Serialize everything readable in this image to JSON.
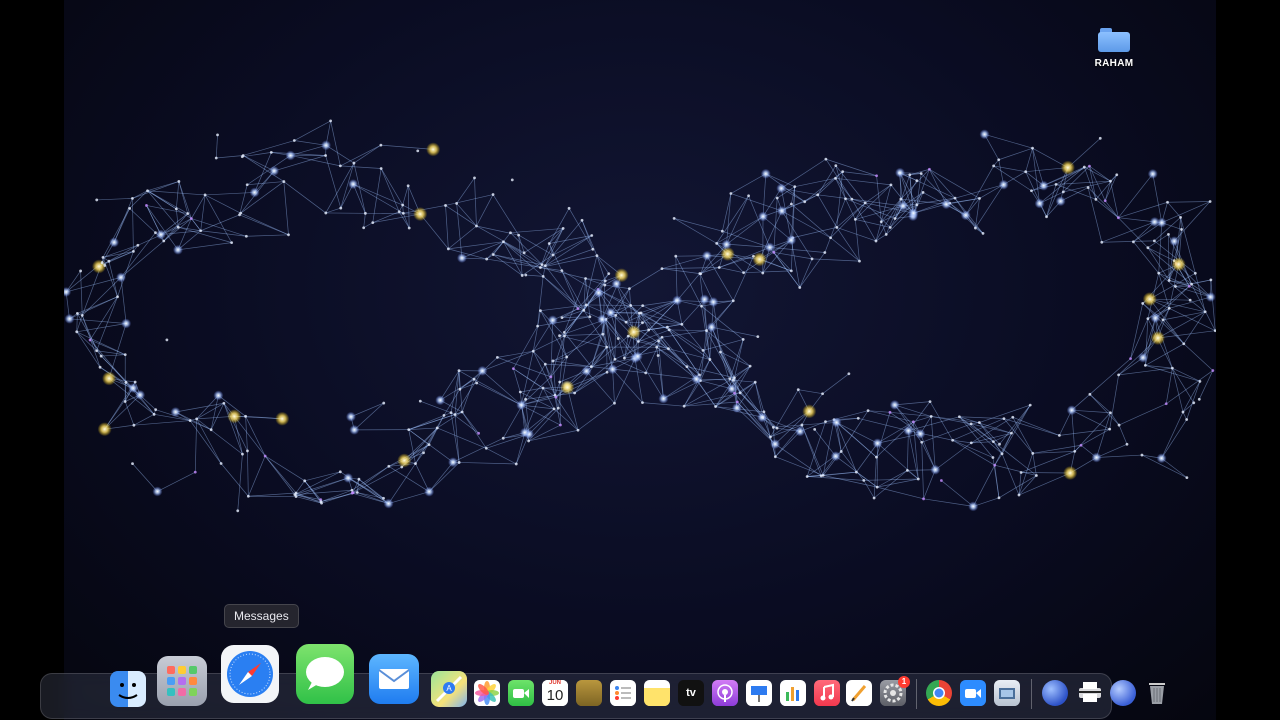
{
  "desktop": {
    "folder": {
      "label": "RAHAM",
      "icon": "folder-icon"
    }
  },
  "tooltip": {
    "text": "Messages"
  },
  "dock": {
    "apps": [
      {
        "id": "finder",
        "icon": "finder-icon"
      },
      {
        "id": "launchpad",
        "icon": "launchpad-icon"
      },
      {
        "id": "safari",
        "icon": "safari-icon"
      },
      {
        "id": "messages",
        "icon": "messages-icon"
      },
      {
        "id": "mail",
        "icon": "mail-icon"
      },
      {
        "id": "maps",
        "icon": "maps-icon"
      },
      {
        "id": "photos",
        "icon": "photos-icon"
      },
      {
        "id": "facetime",
        "icon": "facetime-icon"
      },
      {
        "id": "calendar",
        "icon": "calendar-icon",
        "month": "JUN",
        "day": "10"
      },
      {
        "id": "notes-app",
        "icon": "notes-icon"
      },
      {
        "id": "reminders",
        "icon": "reminders-icon"
      },
      {
        "id": "stickies",
        "icon": "stickies-icon"
      },
      {
        "id": "tv",
        "icon": "tv-icon",
        "label": "tv"
      },
      {
        "id": "podcasts",
        "icon": "podcasts-icon"
      },
      {
        "id": "keynote",
        "icon": "keynote-icon"
      },
      {
        "id": "numbers",
        "icon": "numbers-icon"
      },
      {
        "id": "music",
        "icon": "music-icon"
      },
      {
        "id": "pages",
        "icon": "pages-icon"
      },
      {
        "id": "system-settings",
        "icon": "gear-icon",
        "badge": "1"
      },
      {
        "id": "chrome",
        "icon": "chrome-icon"
      },
      {
        "id": "zoom",
        "icon": "zoom-icon"
      },
      {
        "id": "preview",
        "icon": "preview-icon"
      },
      {
        "id": "globe-1",
        "icon": "globe-icon"
      },
      {
        "id": "printer",
        "icon": "printer-icon"
      },
      {
        "id": "globe-2",
        "icon": "globe-icon"
      },
      {
        "id": "trash",
        "icon": "trash-icon"
      }
    ]
  },
  "colors": {
    "wallpaper_bg": "#0a0c22",
    "network_line": "#9fc4ff",
    "node_glow": "#e8f0ff",
    "node_yellow": "#ffe066"
  }
}
